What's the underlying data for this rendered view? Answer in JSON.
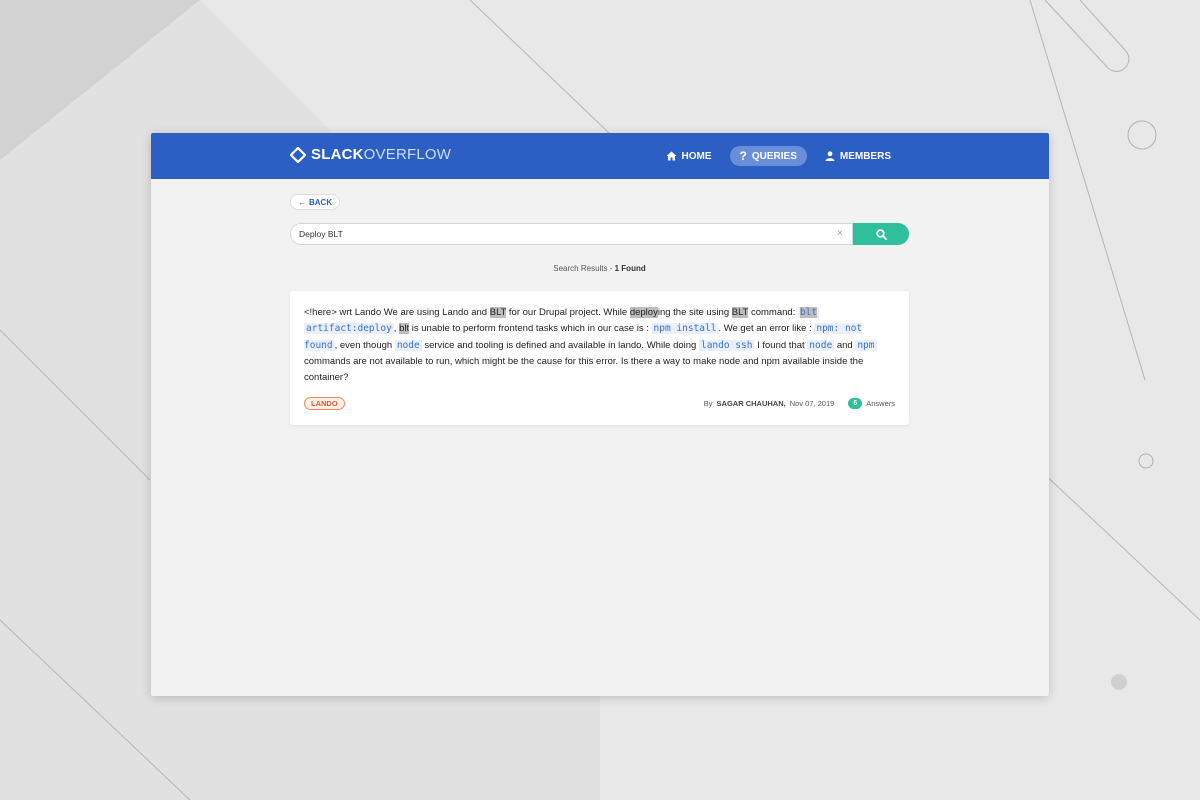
{
  "brand": {
    "part1": "SLACK",
    "part2": "OVERFLOW"
  },
  "nav": {
    "items": [
      {
        "label": "HOME",
        "icon": "home-icon"
      },
      {
        "label": "QUERIES",
        "icon": "question-icon",
        "active": true
      },
      {
        "label": "MEMBERS",
        "icon": "user-icon"
      }
    ]
  },
  "back": {
    "label": "BACK"
  },
  "search": {
    "value": "Deploy BLT",
    "clear": "×"
  },
  "results": {
    "prefix": "Search Results - ",
    "count": "1 Found"
  },
  "result": {
    "segments": [
      {
        "t": "<!here> wrt Lando We are using Lando and "
      },
      {
        "t": "BLT",
        "hl": true
      },
      {
        "t": " for our Drupal project. While "
      },
      {
        "t": "deploy",
        "hl": true
      },
      {
        "t": "ing the site using "
      },
      {
        "t": "BLT",
        "hl": true
      },
      {
        "t": " command: "
      },
      {
        "t": "blt",
        "code": true,
        "hl": true
      },
      {
        "t": " "
      },
      {
        "t": "artifact:deploy",
        "code": true
      },
      {
        "t": ", "
      },
      {
        "t": "blt",
        "hl": true
      },
      {
        "t": " is unable to perform frontend tasks which in our case is : "
      },
      {
        "t": "npm install",
        "code": true
      },
      {
        "t": ". We get an error like : "
      },
      {
        "t": "npm: not found",
        "code": true
      },
      {
        "t": ", even though "
      },
      {
        "t": "node",
        "code": true
      },
      {
        "t": " service and tooling is defined and available in lando. While doing "
      },
      {
        "t": "lando ssh",
        "code": true
      },
      {
        "t": " I found that "
      },
      {
        "t": "node",
        "code": true
      },
      {
        "t": " and "
      },
      {
        "t": "npm",
        "code": true
      },
      {
        "t": " commands are not available to run, which might be the cause for this error. Is there a way to make node and npm available inside the container?"
      }
    ],
    "tag": "LANDO",
    "by": "By",
    "author": "SAGAR CHAUHAN,",
    "date": "Nov 07, 2019",
    "answers_count": "6",
    "answers_label": "Answers"
  },
  "colors": {
    "navbar": "#2c5fc4",
    "accent": "#2fbf9b",
    "tag": "#e2572a"
  }
}
